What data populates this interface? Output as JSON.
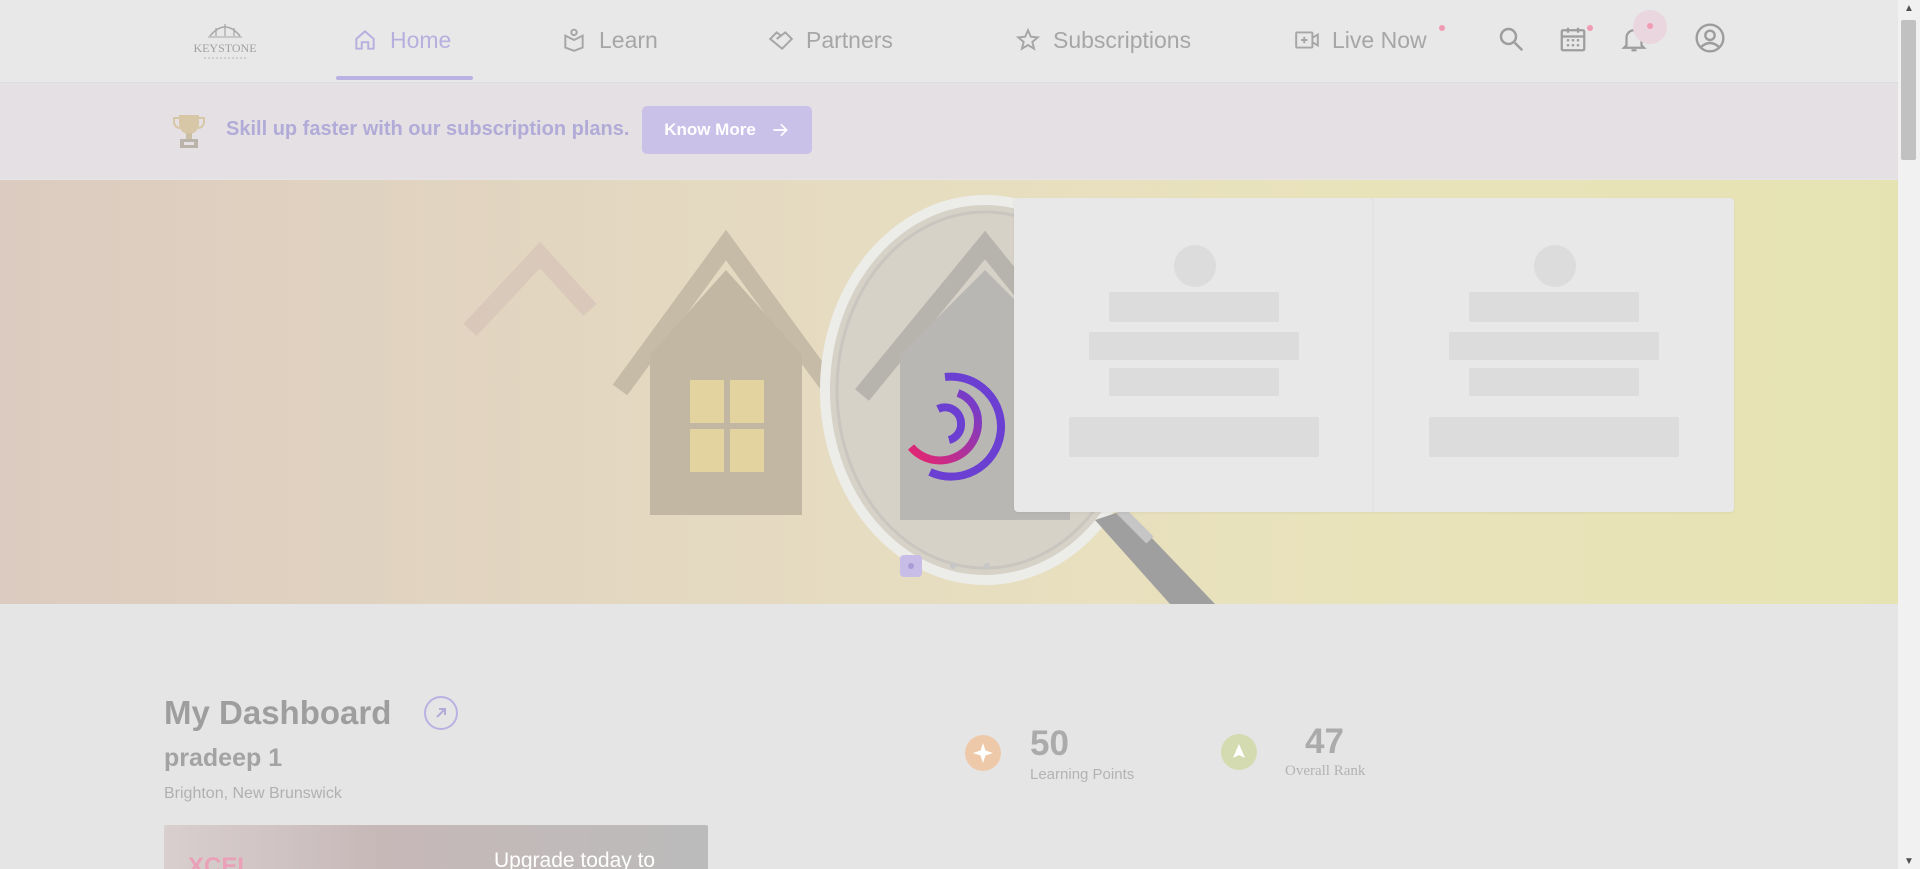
{
  "header": {
    "logo_text": "KEYSTONE",
    "nav": [
      {
        "label": "Home",
        "icon": "home-icon"
      },
      {
        "label": "Learn",
        "icon": "book-icon"
      },
      {
        "label": "Partners",
        "icon": "handshake-icon"
      },
      {
        "label": "Subscriptions",
        "icon": "star-icon"
      },
      {
        "label": "Live Now",
        "icon": "video-plus-icon"
      }
    ],
    "active_nav": "Home",
    "icons": [
      "search-icon",
      "calendar-icon",
      "bell-icon",
      "account-icon"
    ],
    "accent_color": "#b7b0df",
    "notification_dot_color": "#f19ab4"
  },
  "promo": {
    "text": "Skill up faster with our subscription plans.",
    "button_label": "Know More"
  },
  "hero": {
    "carousel_slides": 3,
    "active_slide": 1,
    "loading": true
  },
  "dashboard": {
    "title": "My Dashboard",
    "user_name": "pradeep 1",
    "location": "Brighton, New Brunswick",
    "stats": [
      {
        "value": "50",
        "label": "Learning Points",
        "icon": "sparkle-icon",
        "color": "#edc9a9"
      },
      {
        "value": "47",
        "label": "Overall Rank",
        "icon": "rank-icon",
        "color": "#d5dbb1"
      }
    ],
    "upgrade": {
      "brand": "XCEL",
      "text": "Upgrade today to"
    }
  }
}
